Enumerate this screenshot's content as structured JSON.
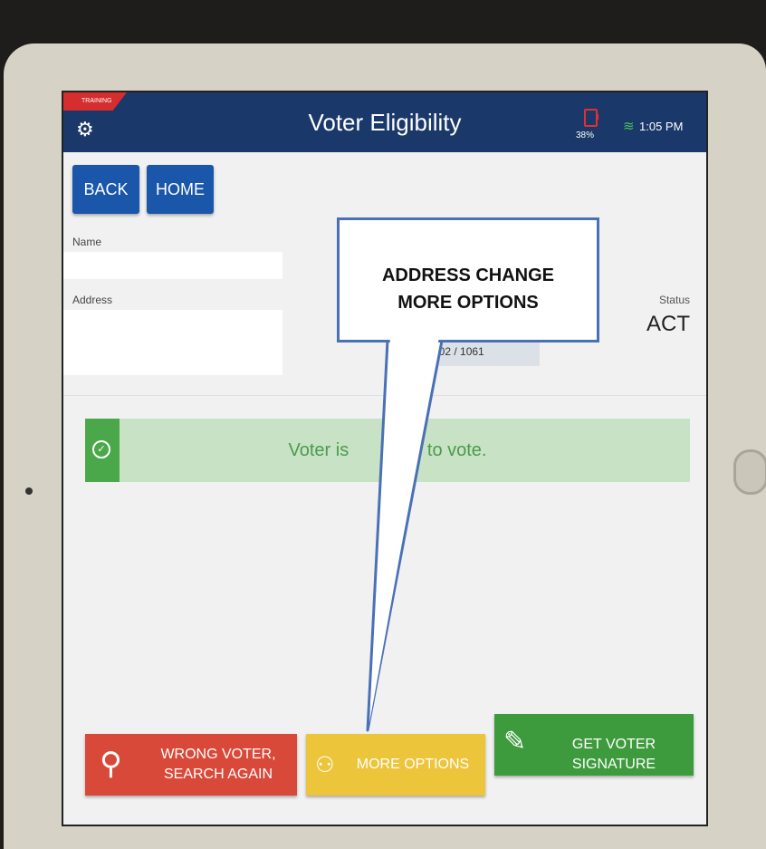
{
  "training_badge": "TRAINING",
  "header": {
    "title": "Voter Eligibility",
    "battery_percent": "38%",
    "time": "1:05 PM",
    "settings_icon": "gear-icon",
    "battery_icon": "battery-icon",
    "wifi_icon": "wifi-icon"
  },
  "nav": {
    "back": "BACK",
    "home": "HOME"
  },
  "voter": {
    "name_label": "Name",
    "address_label": "Address",
    "precinct": "002 / 1061",
    "status_label": "Status",
    "status_value": "ACT"
  },
  "eligibility_message": "Voter is eligible to vote.",
  "eligibility_visible": [
    "Voter is",
    "e to vote."
  ],
  "actions": {
    "wrong_voter": [
      "WRONG VOTER,",
      "SEARCH AGAIN"
    ],
    "more_options": "MORE OPTIONS",
    "get_signature": "GET VOTER SIGNATURE"
  },
  "callout": {
    "line1": "ADDRESS CHANGE",
    "line2": "MORE OPTIONS"
  },
  "colors": {
    "header": "#1a3869",
    "training": "#d62e2e",
    "nav_button": "#1a56a9",
    "eligible_bg": "#c8e2c6",
    "eligible_accent": "#4aa84a",
    "wrong_voter": "#d84939",
    "more_options": "#ecc53a",
    "get_signature": "#3d9b3d",
    "callout_border": "#4a70b6"
  }
}
